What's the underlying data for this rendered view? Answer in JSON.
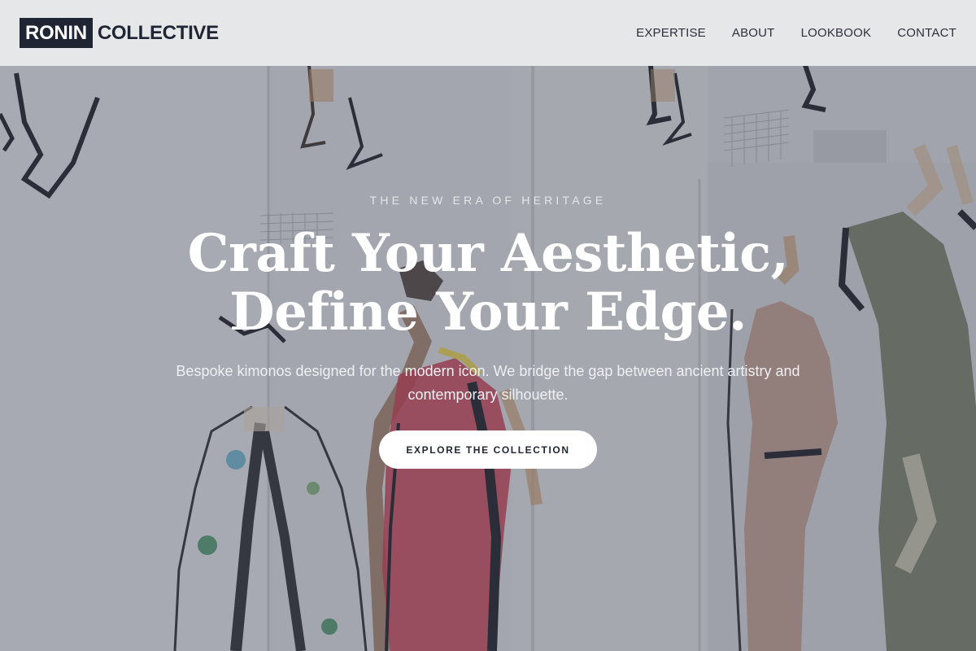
{
  "brand": {
    "logo_box_text": "RONIN",
    "logo_word": "COLLECTIVE"
  },
  "nav": {
    "items": [
      {
        "label": "EXPERTISE"
      },
      {
        "label": "ABOUT"
      },
      {
        "label": "LOOKBOOK"
      },
      {
        "label": "CONTACT"
      }
    ]
  },
  "hero": {
    "eyebrow": "THE NEW ERA OF HERITAGE",
    "headline_line1": "Craft Your Aesthetic,",
    "headline_line2": "Define Your Edge.",
    "subtext": "Bespoke kimonos designed for the modern icon. We bridge the gap between ancient artistry and contemporary silhouette.",
    "cta_label": "EXPLORE THE COLLECTION",
    "background_description_icon": "fashion-sketch-illustration"
  },
  "colors": {
    "header_bg": "#e6e7e9",
    "brand_navy": "#1f2533",
    "cta_bg": "#ffffff",
    "sketch_red": "#c8364a"
  }
}
